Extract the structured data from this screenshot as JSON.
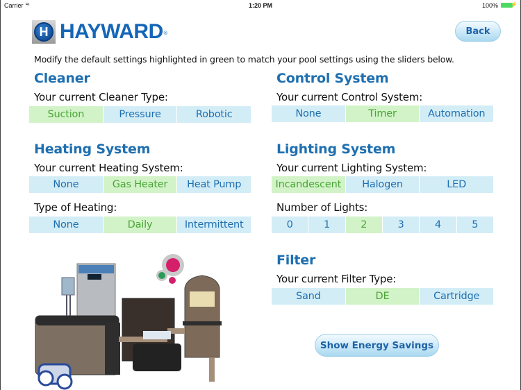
{
  "status_bar": {
    "carrier": "Carrier",
    "wifi_icon": "wifi-icon",
    "time": "1:20 PM",
    "battery_percent": "100%",
    "battery_level": 1.0,
    "battery_icon": "battery-icon",
    "charging_icon": "bolt-icon"
  },
  "header": {
    "logo_letter": "H",
    "logo_text": "HAYWARD",
    "logo_registered": "®",
    "back_label": "Back"
  },
  "instruction": "Modify the default settings highlighted in green to match your pool settings using the sliders below.",
  "colors": {
    "title_blue": "#1e6fb0",
    "option_bg": "#d3edf7",
    "selected_bg": "#d2f3c7",
    "selected_text": "#4aa537"
  },
  "cleaner": {
    "title": "Cleaner",
    "label": "Your current Cleaner Type:",
    "options": [
      "Suction",
      "Pressure",
      "Robotic"
    ],
    "selected": "Suction"
  },
  "control": {
    "title": "Control System",
    "label": "Your current Control System:",
    "options": [
      "None",
      "Timer",
      "Automation"
    ],
    "selected": "Timer"
  },
  "heating": {
    "title": "Heating System",
    "label": "Your current Heating System:",
    "options": [
      "None",
      "Gas Heater",
      "Heat Pump"
    ],
    "selected": "Gas Heater",
    "type_label": "Type of Heating:",
    "type_options": [
      "None",
      "Daily",
      "Intermittent"
    ],
    "type_selected": "Daily"
  },
  "lighting": {
    "title": "Lighting System",
    "label": "Your current Lighting System:",
    "options": [
      "Incandescent",
      "Halogen",
      "LED"
    ],
    "selected": "Incandescent",
    "count_label": "Number of Lights:",
    "count_options": [
      "0",
      "1",
      "2",
      "3",
      "4",
      "5"
    ],
    "count_selected": "2"
  },
  "filter": {
    "title": "Filter",
    "label": "Your current Filter Type:",
    "options": [
      "Sand",
      "DE",
      "Cartridge"
    ],
    "selected": "DE"
  },
  "energy_button": "Show Energy Savings"
}
